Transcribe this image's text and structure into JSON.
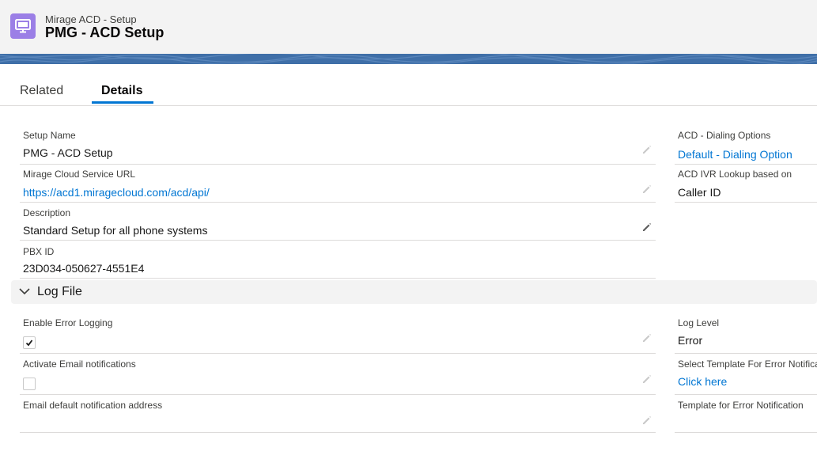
{
  "header": {
    "object_name": "Mirage ACD - Setup",
    "record_title": "PMG - ACD Setup",
    "icon": "desktop-icon",
    "icon_color": "#9b7fe6"
  },
  "tabs": [
    {
      "label": "Related",
      "active": false
    },
    {
      "label": "Details",
      "active": true
    }
  ],
  "details_left": {
    "setup_name": {
      "label": "Setup Name",
      "value": "PMG - ACD Setup"
    },
    "service_url": {
      "label": "Mirage Cloud Service URL",
      "value": "https://acd1.miragecloud.com/acd/api/"
    },
    "description": {
      "label": "Description",
      "value": "Standard Setup for all phone systems"
    },
    "pbx_id": {
      "label": "PBX ID",
      "value": "23D034-050627-4551E4"
    }
  },
  "details_right": {
    "dialing_options": {
      "label": "ACD - Dialing Options",
      "value": "Default - Dialing Option"
    },
    "ivr_lookup": {
      "label": "ACD IVR Lookup based on",
      "value": "Caller ID"
    }
  },
  "log_section": {
    "title": "Log File",
    "enable_error_logging": {
      "label": "Enable Error Logging",
      "checked": true
    },
    "activate_email": {
      "label": "Activate Email notifications",
      "checked": false
    },
    "email_address": {
      "label": "Email default notification address",
      "value": ""
    },
    "log_level": {
      "label": "Log Level",
      "value": "Error"
    },
    "select_template": {
      "label": "Select Template For Error Notification",
      "value": "Click here"
    },
    "template_error": {
      "label": "Template for Error Notification",
      "value": ""
    }
  },
  "colors": {
    "link": "#0176d3",
    "banner": "#3f6fa8",
    "tab_active": "#0176d3"
  }
}
